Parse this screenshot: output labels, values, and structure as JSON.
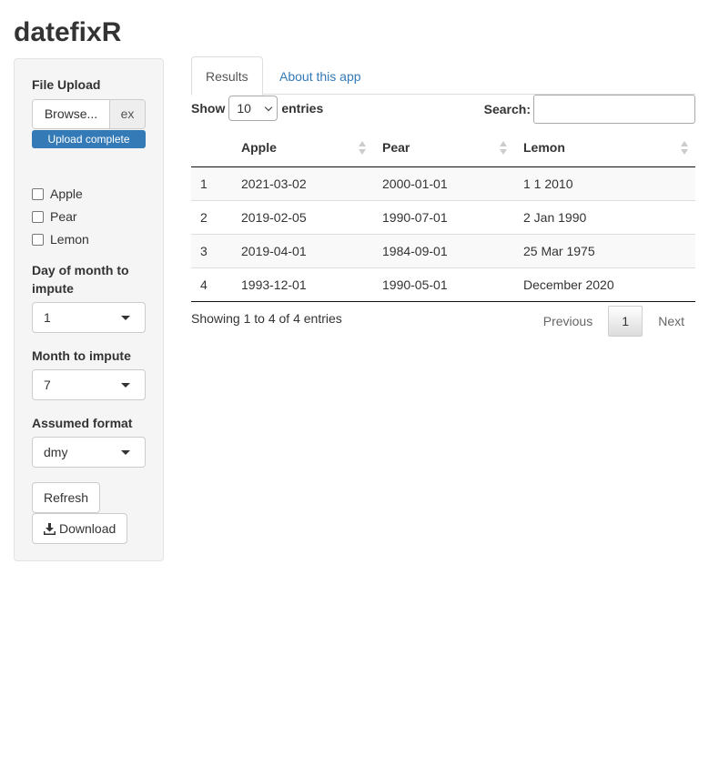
{
  "app": {
    "title": "datefixR"
  },
  "sidebar": {
    "file_upload_label": "File Upload",
    "browse_label": "Browse...",
    "file_name": "ex",
    "progress_label": "Upload complete",
    "checkboxes": [
      {
        "label": "Apple",
        "checked": false
      },
      {
        "label": "Pear",
        "checked": false
      },
      {
        "label": "Lemon",
        "checked": false
      }
    ],
    "day_label": "Day of month to impute",
    "day_value": "1",
    "month_label": "Month to impute",
    "month_value": "7",
    "format_label": "Assumed format",
    "format_value": "dmy",
    "refresh_label": "Refresh",
    "download_label": "Download"
  },
  "tabs": [
    {
      "label": "Results",
      "active": true
    },
    {
      "label": "About this app",
      "active": false
    }
  ],
  "table_controls": {
    "show_label": "Show",
    "entries_value": "10",
    "entries_label": "entries",
    "search_label": "Search:",
    "search_value": ""
  },
  "table": {
    "columns": [
      "",
      "Apple",
      "Pear",
      "Lemon"
    ],
    "rows": [
      [
        "1",
        "2021-03-02",
        "2000-01-01",
        "1 1 2010"
      ],
      [
        "2",
        "2019-02-05",
        "1990-07-01",
        "2 Jan 1990"
      ],
      [
        "3",
        "2019-04-01",
        "1984-09-01",
        "25 Mar 1975"
      ],
      [
        "4",
        "1993-12-01",
        "1990-05-01",
        "December 2020"
      ]
    ]
  },
  "pagination": {
    "info": "Showing 1 to 4 of 4 entries",
    "previous": "Previous",
    "current": "1",
    "next": "Next"
  },
  "colors": {
    "accent": "#337ab7",
    "sidebar_bg": "#f5f5f5"
  }
}
